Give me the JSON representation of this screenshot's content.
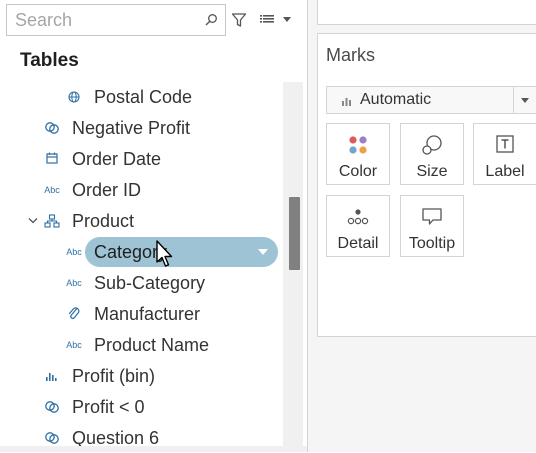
{
  "search": {
    "placeholder": "Search",
    "value": ""
  },
  "data_pane": {
    "heading": "Tables",
    "fields": [
      {
        "label": "Postal Code",
        "icon": "globe-icon",
        "type_text": ""
      },
      {
        "label": "Negative Profit",
        "icon": "set-icon",
        "type_text": ""
      },
      {
        "label": "Order Date",
        "icon": "calendar-icon",
        "type_text": ""
      },
      {
        "label": "Order ID",
        "icon": "abc-icon",
        "type_text": "Abc"
      },
      {
        "label": "Product",
        "icon": "hierarchy-icon",
        "type_text": ""
      },
      {
        "label": "Sub-Category",
        "icon": "abc-icon",
        "type_text": "Abc"
      },
      {
        "label": "Manufacturer",
        "icon": "paperclip-icon",
        "type_text": ""
      },
      {
        "label": "Product Name",
        "icon": "abc-icon",
        "type_text": "Abc"
      },
      {
        "label": "Profit (bin)",
        "icon": "histogram-icon",
        "type_text": ""
      },
      {
        "label": "Profit < 0",
        "icon": "set-icon",
        "type_text": ""
      },
      {
        "label": "Question 6",
        "icon": "set-icon",
        "type_text": ""
      }
    ],
    "dragged_pill": {
      "label": "Category",
      "type_text": "Abc"
    }
  },
  "marks": {
    "title": "Marks",
    "mark_type": "Automatic",
    "buttons": [
      {
        "label": "Color",
        "icon": "color-icon"
      },
      {
        "label": "Size",
        "icon": "size-icon"
      },
      {
        "label": "Label",
        "icon": "label-icon"
      },
      {
        "label": "Detail",
        "icon": "detail-icon"
      },
      {
        "label": "Tooltip",
        "icon": "tooltip-icon"
      }
    ]
  },
  "colors": {
    "field_icon": "#2f6fa3",
    "pill": "#9dc3d4",
    "color_dots": [
      "#e05a5a",
      "#9b7fc7",
      "#6fa6cf",
      "#f0a044"
    ]
  }
}
